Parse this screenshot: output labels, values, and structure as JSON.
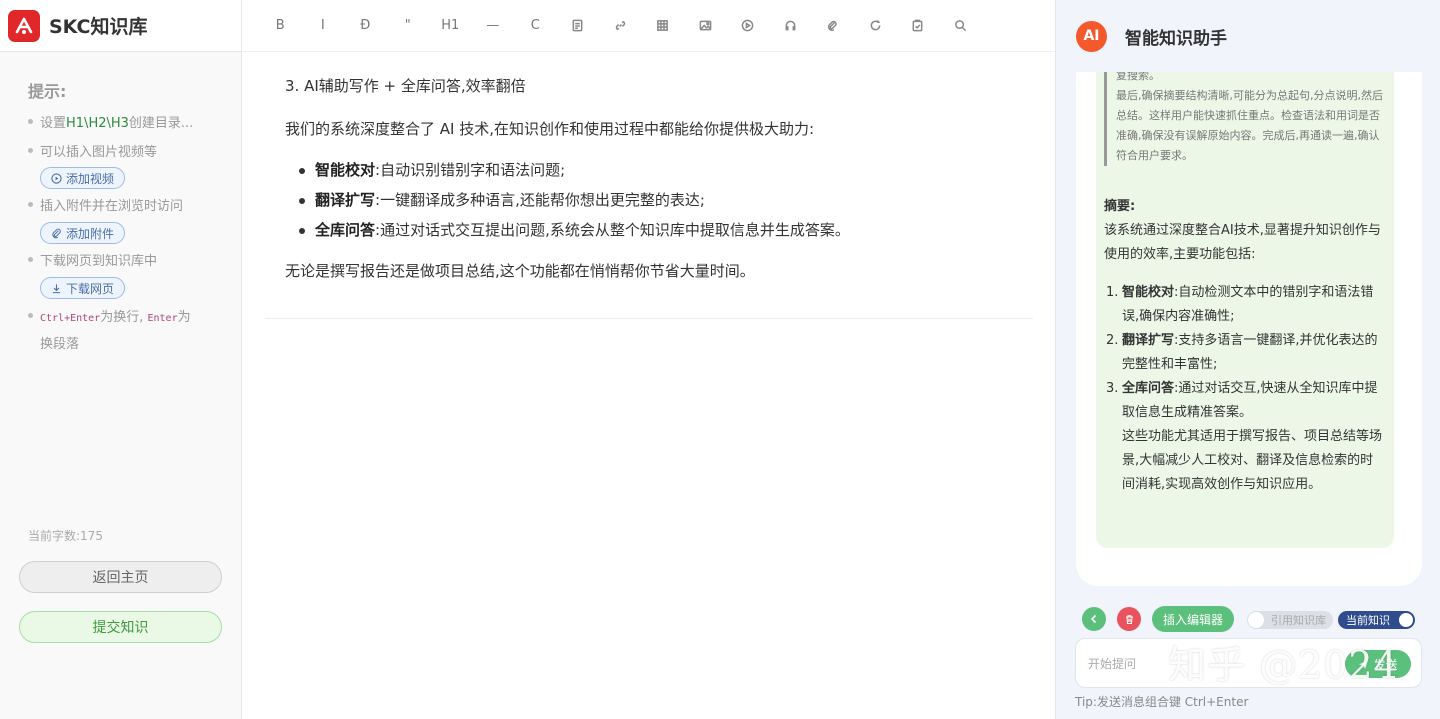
{
  "app": {
    "logo_text": "SKC知识库"
  },
  "sidebar": {
    "tips_title": "提示:",
    "tips": [
      {
        "pre": "设置",
        "highlight": "H1\\H2\\H3",
        "post": "创建目录..."
      },
      {
        "text": "可以插入图片视频等"
      },
      {
        "text": "插入附件并在浏览时访问"
      },
      {
        "text": "下载网页到知识库中"
      }
    ],
    "tip_shortcut": {
      "key1": "Ctrl+Enter",
      "mid": "为换行,",
      "key2": "Enter",
      "post": "为",
      "line2": "换段落"
    },
    "add_video_label": "添加视频",
    "add_attachment_label": "添加附件",
    "download_page_label": "下载网页",
    "word_count": "当前字数:175",
    "home_label": "返回主页",
    "submit_label": "提交知识"
  },
  "toolbar": {
    "bold": "B",
    "italic": "I",
    "strike": "Đ",
    "quote": "\"",
    "heading": "H1",
    "hr": "—",
    "code": "C"
  },
  "editor": {
    "heading_line": "3. AI辅助写作 + 全库问答,效率翻倍",
    "intro": "我们的系统深度整合了 AI 技术,在知识创作和使用过程中都能给你提供极大助力:",
    "bullets": [
      {
        "term": "智能校对",
        "desc": ":自动识别错别字和语法问题;"
      },
      {
        "term": "翻译扩写",
        "desc": ":一键翻译成多种语言,还能帮你想出更完整的表达;"
      },
      {
        "term": "全库问答",
        "desc": ":通过对话式交互提出问题,系统会从整个知识库中提取信息并生成答案。"
      }
    ],
    "outro": "无论是撰写报告还是做项目总结,这个功能都在悄悄帮你节省大量时间。"
  },
  "ai": {
    "badge": "AI",
    "title": "智能知识助手",
    "quote_lines": [
      "复搜索。",
      "最后,确保摘要结构清晰,可能分为总起句,分点说明,然后总结。这样用户能快速抓住重点。检查语法和用词是否准确,确保没有误解原始内容。完成后,再通读一遍,确认符合用户要求。"
    ],
    "summary_label": "摘要:",
    "summary_text": "该系统通过深度整合AI技术,显著提升知识创作与使用的效率,主要功能包括:",
    "items": [
      {
        "num": "1.",
        "term": "智能校对",
        "desc": ":自动检测文本中的错别字和语法错误,确保内容准确性;"
      },
      {
        "num": "2.",
        "term": "翻译扩写",
        "desc": ":支持多语言一键翻译,并优化表达的完整性和丰富性;"
      },
      {
        "num": "3.",
        "term": "全库问答",
        "desc": ":通过对话交互,快速从全知识库中提取信息生成精准答案。"
      }
    ],
    "tail": "这些功能尤其适用于撰写报告、项目总结等场景,大幅减少人工校对、翻译及信息检索的时间消耗,实现高效创作与知识应用。",
    "insert_label": "插入编辑器",
    "toggle_library_label": "引用知识库",
    "toggle_current_label": "当前知识",
    "input_placeholder": "开始提问",
    "send_label": "发送",
    "hint": "Tip:发送消息组合键 Ctrl+Enter"
  },
  "watermark": "知乎 @2024",
  "colors": {
    "accent_green": "#5cc07d",
    "brand_red": "#e0282b",
    "ai_orange": "#f4592e",
    "toggle_blue": "#2f4c8f"
  }
}
